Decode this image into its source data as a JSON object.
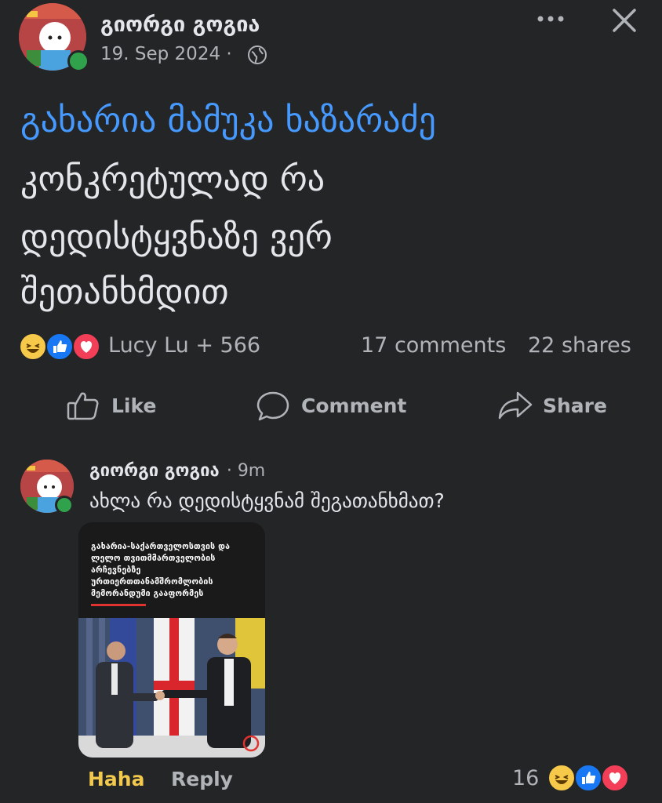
{
  "post": {
    "author": "გიორგი გოგია",
    "date": "19. Sep 2024 ·",
    "link_text": "გახარია მამუკა ხაზარაძე",
    "lines": [
      "კონკრეტულად რა",
      "დედისტყვნაზე ვერ",
      "შეთანხმდით"
    ]
  },
  "stats": {
    "reactors": "Lucy Lu + 566",
    "comments": "17 comments",
    "shares": "22 shares"
  },
  "actions": {
    "like": "Like",
    "comment": "Comment",
    "share": "Share"
  },
  "comment": {
    "author": "გიორგი გოგია",
    "time": "· 9m",
    "text": "ახლა რა დედისტყვნამ შეგათანხმათ?",
    "image_title_lines": [
      "გახარია-საქართველოსთვის და",
      "ლელო თვითმმართველობის",
      "არჩევნებზე",
      "ურთიერთთანამშრომლობის",
      "მემორანდუმი გააფორმეს"
    ],
    "haha": "Haha",
    "reply": "Reply",
    "reaction_count": "16"
  },
  "colors": {
    "background": "#242526",
    "link_blue": "#4599ff",
    "haha_yellow": "#f2c94c",
    "online_green": "#31a24c"
  },
  "icons": [
    "more-icon",
    "close-icon",
    "globe-icon",
    "haha-reaction-icon",
    "like-reaction-icon",
    "love-reaction-icon",
    "like-icon",
    "comment-icon",
    "share-icon"
  ]
}
